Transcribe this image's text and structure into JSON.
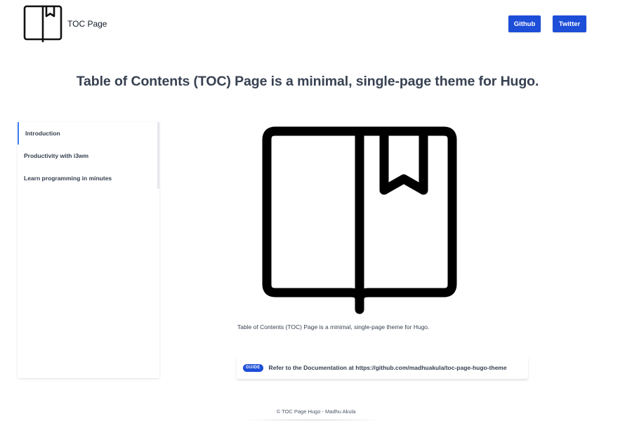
{
  "header": {
    "brand_name": "TOC Page",
    "brand_icon": "book-bookmark-icon",
    "nav": [
      {
        "label": "Github"
      },
      {
        "label": "Twitter"
      }
    ]
  },
  "headline": "Table of Contents (TOC) Page is a minimal, single-page theme for Hugo.",
  "sidebar": {
    "items": [
      {
        "label": "Introduction",
        "active": true
      },
      {
        "label": "Productivity with i3wm",
        "active": false
      },
      {
        "label": "Learn programming in minutes",
        "active": false
      }
    ]
  },
  "main": {
    "hero_icon": "book-bookmark-icon",
    "description": "Table of Contents (TOC) Page is a minimal, single-page theme for Hugo.",
    "guide": {
      "badge": "GUIDE",
      "text": "Refer to the Documentation at https://github.com/madhuakula/toc-page-hugo-theme"
    }
  },
  "footer": {
    "text": "© TOC Page Hugo - Madhu Akula"
  },
  "colors": {
    "accent": "#1d4ed8",
    "active_border": "#3b82f6",
    "text": "#374151"
  }
}
